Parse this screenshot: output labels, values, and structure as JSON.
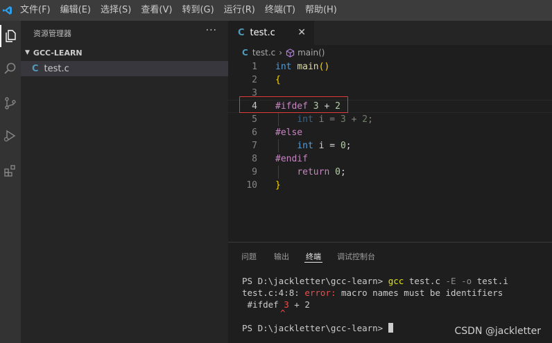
{
  "menubar": {
    "items": [
      "文件(F)",
      "编辑(E)",
      "选择(S)",
      "查看(V)",
      "转到(G)",
      "运行(R)",
      "终端(T)",
      "帮助(H)"
    ]
  },
  "sidebar": {
    "title": "资源管理器",
    "more": "···",
    "folder": "GCC-LEARN",
    "file_badge": "C",
    "file": "test.c"
  },
  "editor": {
    "tab_badge": "C",
    "tab_label": "test.c",
    "tab_close": "✕",
    "breadcrumb": {
      "badge": "C",
      "file": "test.c",
      "symbol": "main()"
    },
    "lines": [
      {
        "n": "1",
        "tokens": [
          [
            "int",
            "kw-blue"
          ],
          [
            " ",
            "plain"
          ],
          [
            "main",
            "fn-yellow"
          ],
          [
            "()",
            "brace"
          ]
        ]
      },
      {
        "n": "2",
        "tokens": [
          [
            "{",
            "brace"
          ]
        ]
      },
      {
        "n": "3",
        "tokens": []
      },
      {
        "n": "4",
        "tokens": [
          [
            "#ifdef",
            "kw-pink"
          ],
          [
            " ",
            "plain"
          ],
          [
            "3",
            "num"
          ],
          [
            " + ",
            "plain"
          ],
          [
            "2",
            "num"
          ]
        ]
      },
      {
        "n": "5",
        "tokens": [
          [
            "    ",
            "plain"
          ],
          [
            "int",
            "kw-blue dim"
          ],
          [
            " i = ",
            "plain dim"
          ],
          [
            "3",
            "num dim"
          ],
          [
            " + ",
            "plain dim"
          ],
          [
            "2",
            "num dim"
          ],
          [
            ";",
            "plain dim"
          ]
        ]
      },
      {
        "n": "6",
        "tokens": [
          [
            "#else",
            "kw-pink"
          ]
        ]
      },
      {
        "n": "7",
        "tokens": [
          [
            "    ",
            "plain"
          ],
          [
            "int",
            "kw-blue"
          ],
          [
            " i = ",
            "plain"
          ],
          [
            "0",
            "num"
          ],
          [
            ";",
            "plain"
          ]
        ]
      },
      {
        "n": "8",
        "tokens": [
          [
            "#endif",
            "kw-pink"
          ]
        ]
      },
      {
        "n": "9",
        "tokens": [
          [
            "    ",
            "plain"
          ],
          [
            "return",
            "kw-pink"
          ],
          [
            " ",
            "plain"
          ],
          [
            "0",
            "num"
          ],
          [
            ";",
            "plain"
          ]
        ]
      },
      {
        "n": "10",
        "tokens": [
          [
            "}",
            "brace"
          ]
        ]
      }
    ]
  },
  "panel": {
    "tabs": [
      "问题",
      "输出",
      "终端",
      "调试控制台"
    ],
    "active_tab": "终端",
    "terminal": {
      "prompt1": "PS D:\\jackletter\\gcc-learn> ",
      "cmd_gcc": "gcc",
      "cmd_file": " test.c ",
      "cmd_flag1": "-E",
      "cmd_space": " ",
      "cmd_flag2": "-o",
      "cmd_out": " test.i",
      "err_loc": "test.c:4:8: ",
      "err_word": "error:",
      "err_msg": " macro names must be identifiers",
      "src_pre": " #ifdef ",
      "src_num": "3",
      "src_post": " + 2",
      "caret": "^",
      "prompt2": "PS D:\\jackletter\\gcc-learn> "
    }
  },
  "watermark": "CSDN @jackletter",
  "colors": {
    "accent_red": "#e03a3a",
    "c_file_blue": "#519aba",
    "error_red": "#f14c4c"
  }
}
